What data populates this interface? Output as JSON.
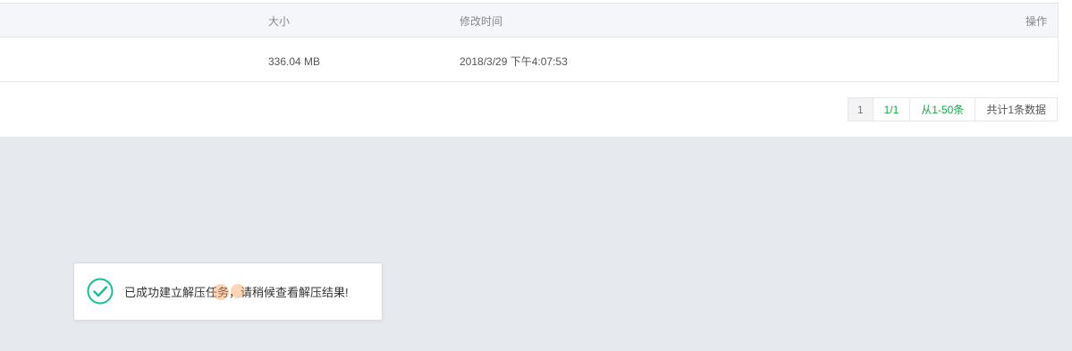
{
  "file_table": {
    "columns": {
      "size": "大小",
      "modified": "修改时间",
      "actions": "操作"
    },
    "rows": [
      {
        "size": "336.04 MB",
        "modified": "2018/3/29 下午4:07:53"
      }
    ]
  },
  "pagination": {
    "current_page": "1",
    "page_of": "1/1",
    "range": "从1-50条",
    "total": "共计1条数据"
  },
  "toast": {
    "icon": "check-circle-icon",
    "message": "已成功建立解压任务，请稍候查看解压结果!",
    "accent_color": "#1abc9c"
  },
  "colors": {
    "header_bg": "#f5f6fa",
    "overlay_bg": "#e6e9ee",
    "link_green": "#1aa94c"
  }
}
